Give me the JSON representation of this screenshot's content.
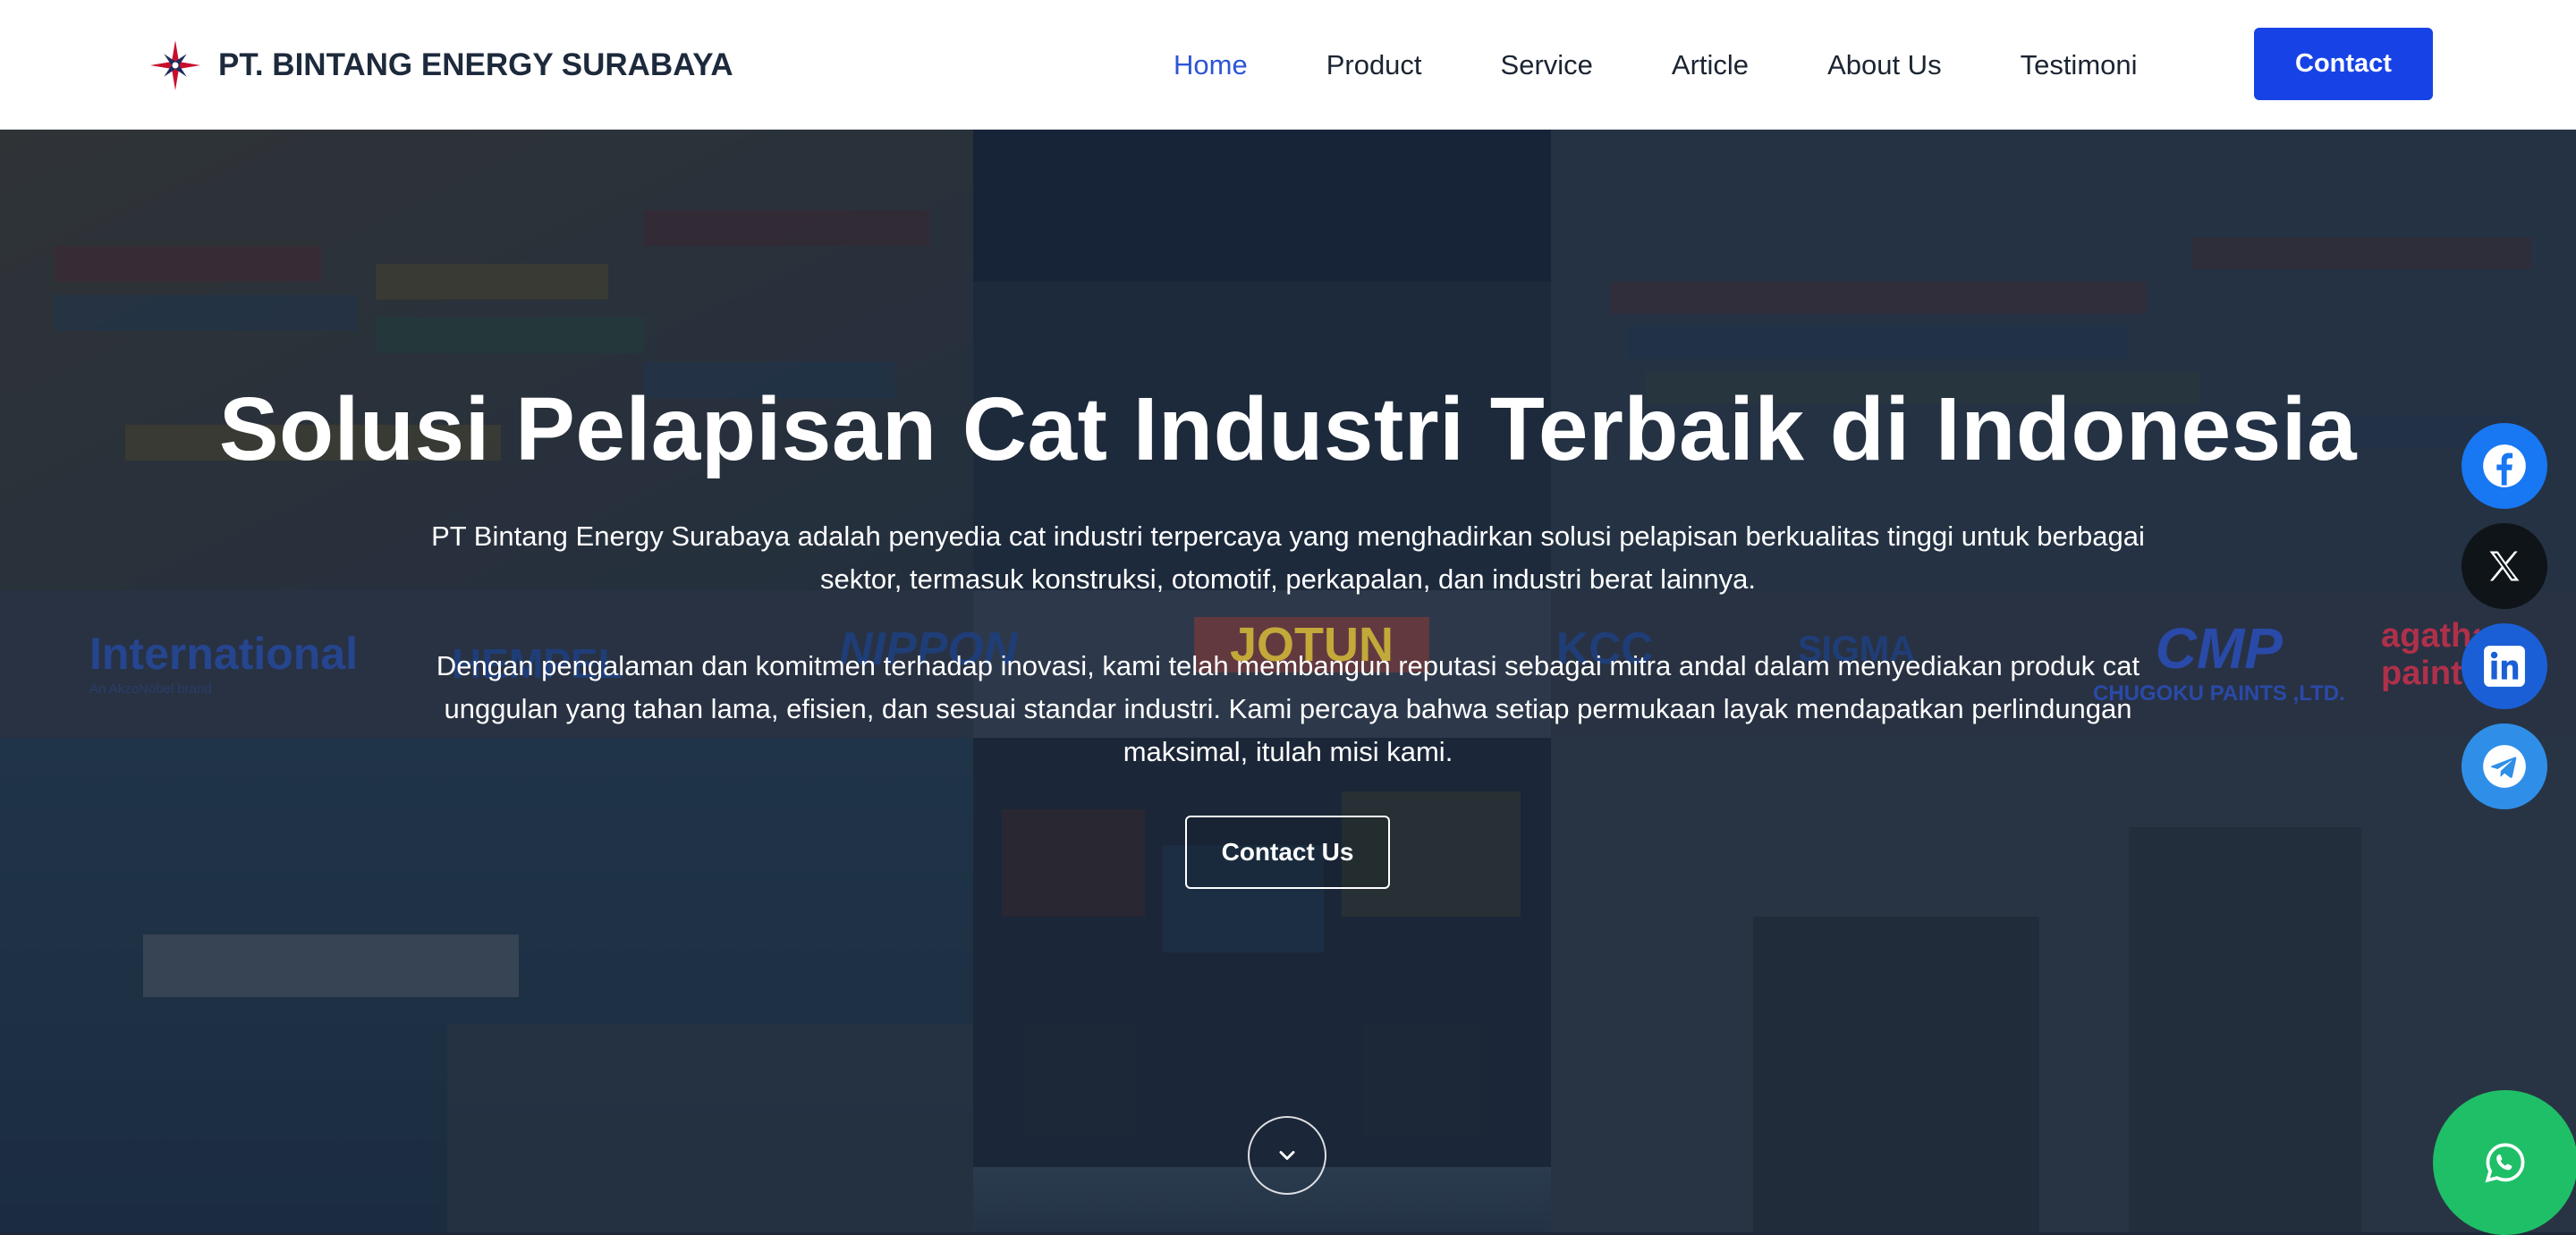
{
  "header": {
    "brand_name": "PT. BINTANG ENERGY SURABAYA",
    "nav": [
      {
        "label": "Home",
        "active": true
      },
      {
        "label": "Product",
        "active": false
      },
      {
        "label": "Service",
        "active": false
      },
      {
        "label": "Article",
        "active": false
      },
      {
        "label": "About Us",
        "active": false
      },
      {
        "label": "Testimoni",
        "active": false
      }
    ],
    "contact_label": "Contact"
  },
  "hero": {
    "title": "Solusi Pelapisan Cat Industri Terbaik di Indonesia",
    "paragraph_1": "PT Bintang Energy Surabaya adalah penyedia cat industri terpercaya yang menghadirkan solusi pelapisan berkualitas tinggi untuk berbagai sektor, termasuk konstruksi, otomotif, perkapalan, dan industri berat lainnya.",
    "paragraph_2": "Dengan pengalaman dan komitmen terhadap inovasi, kami telah membangun reputasi sebagai mitra andal dalam menyediakan produk cat unggulan yang tahan lama, efisien, dan sesuai standar industri. Kami percaya bahwa setiap permukaan layak mendapatkan perlindungan maksimal, itulah misi kami.",
    "cta_label": "Contact Us"
  },
  "brand_strip": [
    {
      "name": "International",
      "sub": "An AkzoNobel brand"
    },
    {
      "name": "HEMPEL"
    },
    {
      "name": "NIPPON"
    },
    {
      "name": "JOTUN"
    },
    {
      "name": "KCC"
    },
    {
      "name": "SIGMA"
    },
    {
      "name": "CMP",
      "sub": "CHUGOKU PAINTS ,LTD."
    },
    {
      "name": "agatha paint"
    }
  ],
  "social": [
    {
      "icon": "facebook-icon",
      "color": "#1877f2"
    },
    {
      "icon": "x-icon",
      "color": "#0f1419"
    },
    {
      "icon": "linkedin-icon",
      "color": "#0a66c2"
    },
    {
      "icon": "telegram-icon",
      "color": "#229ed9"
    }
  ],
  "whatsapp": {
    "icon": "whatsapp-icon",
    "color": "#1fbf67"
  },
  "colors": {
    "accent": "#1743e6",
    "active_nav": "#2d55d6"
  }
}
